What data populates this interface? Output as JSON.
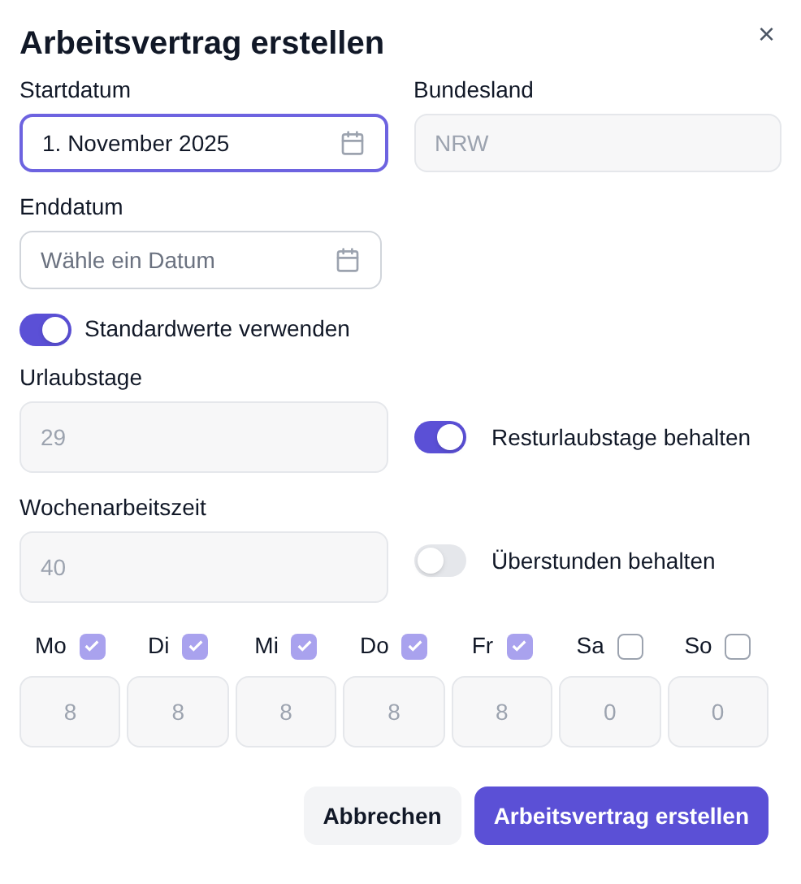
{
  "dialog": {
    "title": "Arbeitsvertrag erstellen",
    "close": "×"
  },
  "start": {
    "label": "Startdatum",
    "value": "1. November 2025",
    "focused": true
  },
  "state": {
    "label": "Bundesland",
    "value": "NRW",
    "disabled": true
  },
  "end": {
    "label": "Enddatum",
    "placeholder": "Wähle ein Datum",
    "focused": false
  },
  "defaults": {
    "label": "Standardwerte verwenden",
    "on": true
  },
  "vacation": {
    "label": "Urlaubstage",
    "value": "29",
    "disabled": true
  },
  "keep_vacation": {
    "label": "Resturlaubstage behalten",
    "on": true
  },
  "hours": {
    "label": "Wochenarbeitszeit",
    "value": "40",
    "disabled": true
  },
  "keep_overtime": {
    "label": "Überstunden behalten",
    "on": false
  },
  "days": [
    {
      "label": "Mo",
      "checked": true,
      "hours": "8"
    },
    {
      "label": "Di",
      "checked": true,
      "hours": "8"
    },
    {
      "label": "Mi",
      "checked": true,
      "hours": "8"
    },
    {
      "label": "Do",
      "checked": true,
      "hours": "8"
    },
    {
      "label": "Fr",
      "checked": true,
      "hours": "8"
    },
    {
      "label": "Sa",
      "checked": false,
      "hours": "0"
    },
    {
      "label": "So",
      "checked": false,
      "hours": "0"
    }
  ],
  "buttons": {
    "cancel": "Abbrechen",
    "submit": "Arbeitsvertrag erstellen"
  }
}
